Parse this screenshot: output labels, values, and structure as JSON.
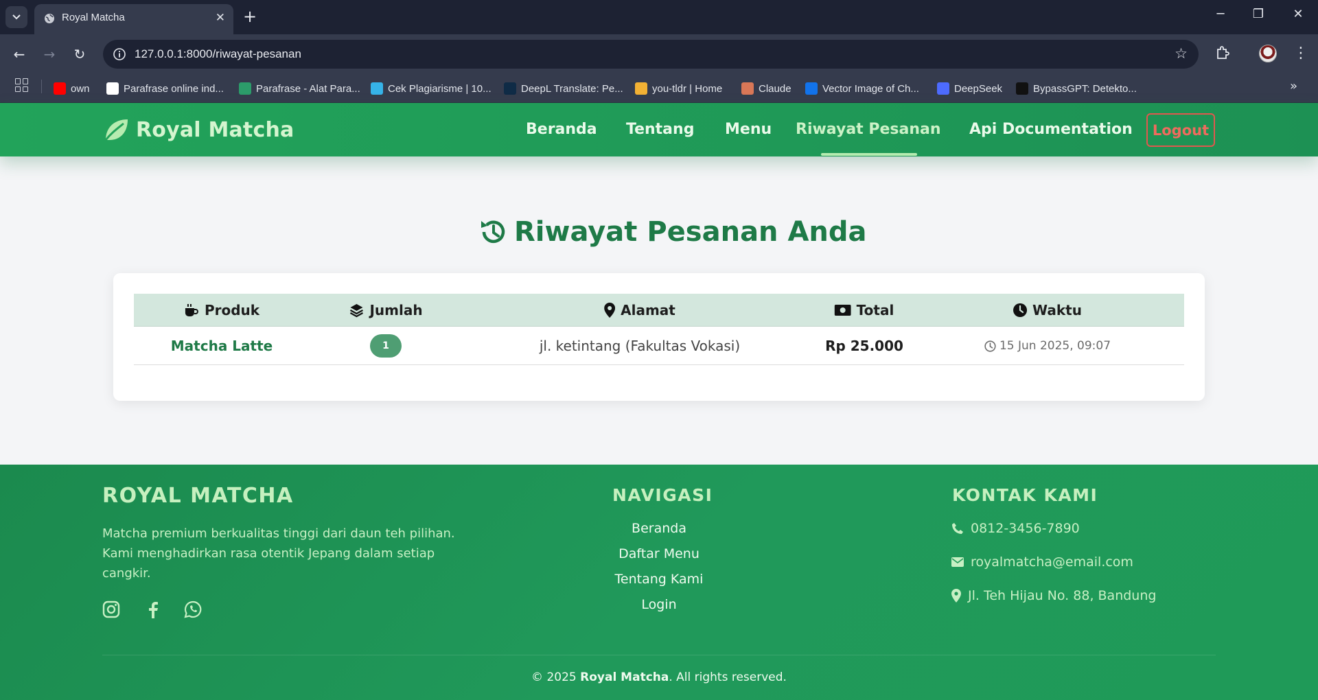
{
  "browser": {
    "tab_title": "Royal Matcha",
    "url": "127.0.0.1:8000/riwayat-pesanan",
    "bookmarks": [
      {
        "label": "own",
        "icon": "youtube-icon",
        "color": "#ff0000"
      },
      {
        "label": "Parafrase online ind...",
        "icon": "parafrase-icon",
        "color": "#ffffff"
      },
      {
        "label": "Parafrase - Alat Para...",
        "icon": "quillbot-icon",
        "color": "#2c9c6a"
      },
      {
        "label": "Cek Plagiarisme | 10...",
        "icon": "plagiarism-icon",
        "color": "#36b3e8"
      },
      {
        "label": "DeepL Translate: Pe...",
        "icon": "deepl-icon",
        "color": "#0f2b46"
      },
      {
        "label": "you-tldr | Home",
        "icon": "pencil-icon",
        "color": "#f2b134"
      },
      {
        "label": "Claude",
        "icon": "claude-icon",
        "color": "#d97757"
      },
      {
        "label": "Vector Image of Ch...",
        "icon": "freepik-icon",
        "color": "#1273eb"
      },
      {
        "label": "DeepSeek",
        "icon": "deepseek-icon",
        "color": "#4d6bfe"
      },
      {
        "label": "BypassGPT: Detekto...",
        "icon": "bypassgpt-icon",
        "color": "#111111"
      }
    ]
  },
  "nav": {
    "brand": "Royal Matcha",
    "links": [
      "Beranda",
      "Tentang",
      "Menu",
      "Riwayat Pesanan",
      "Api Documentation"
    ],
    "active": "Riwayat Pesanan",
    "logout": "Logout",
    "logout_color": "#e2574e"
  },
  "main": {
    "title": "Riwayat Pesanan Anda",
    "table": {
      "headers": [
        "Produk",
        "Jumlah",
        "Alamat",
        "Total",
        "Waktu"
      ],
      "rows": [
        {
          "product": "Matcha Latte",
          "qty": "1",
          "address": "jl. ketintang (Fakultas Vokasi)",
          "total": "Rp 25.000",
          "time": "15 Jun 2025, 09:07"
        }
      ]
    }
  },
  "footer": {
    "brand": "ROYAL MATCHA",
    "description": "Matcha premium berkualitas tinggi dari daun teh pilihan. Kami menghadirkan rasa otentik Jepang dalam setiap cangkir.",
    "nav_heading": "NAVIGASI",
    "nav_links": [
      "Beranda",
      "Daftar Menu",
      "Tentang Kami",
      "Login"
    ],
    "contact_heading": "KONTAK KAMI",
    "phone": "0812-3456-7890",
    "email": "royalmatcha@email.com",
    "address": "Jl. Teh Hijau No. 88, Bandung",
    "copyright_prefix": "© 2025",
    "copyright_brand": "Royal Matcha",
    "copyright_suffix": ". All rights reserved."
  },
  "colors": {
    "brand_green": "#22a35a",
    "heading_green": "#1e7a47",
    "footer_green": "#1f9a58"
  }
}
